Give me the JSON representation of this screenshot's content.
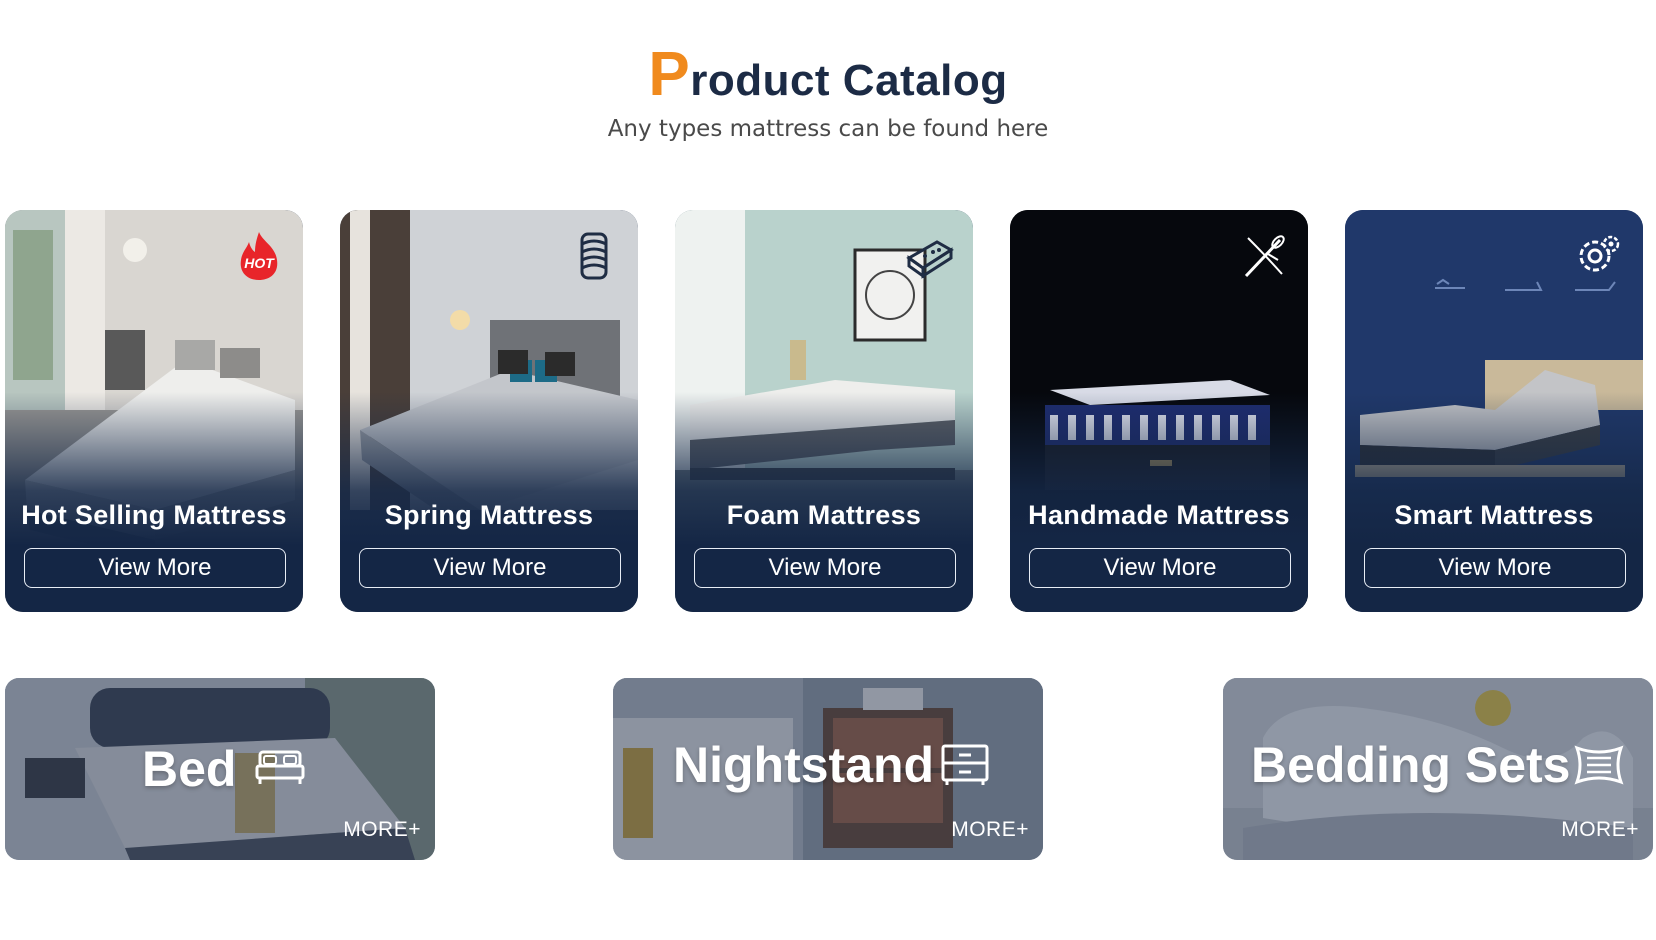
{
  "header": {
    "title_first_letter": "P",
    "title_rest": "roduct Catalog",
    "subtitle": "Any types mattress can be found here",
    "accent_color": "#f08a1d",
    "title_color": "#1c2b45"
  },
  "cards": [
    {
      "title": "Hot Selling Mattress",
      "button": "View More",
      "icon": "hot-flame-icon",
      "badge_text": "HOT"
    },
    {
      "title": "Spring Mattress",
      "button": "View More",
      "icon": "coil-spring-icon"
    },
    {
      "title": "Foam Mattress",
      "button": "View More",
      "icon": "foam-block-icon"
    },
    {
      "title": "Handmade Mattress",
      "button": "View More",
      "icon": "needle-thread-icon"
    },
    {
      "title": "Smart Mattress",
      "button": "View More",
      "icon": "gear-icon"
    }
  ],
  "wide_tiles": [
    {
      "title": "Bed",
      "more": "MORE+",
      "icon": "bed-icon"
    },
    {
      "title": "Nightstand",
      "more": "MORE+",
      "icon": "drawer-cabinet-icon"
    },
    {
      "title": "Bedding Sets",
      "more": "MORE+",
      "icon": "pillow-icon"
    }
  ],
  "colors": {
    "card_bg": "#152847",
    "tile_overlay": "#1e2d48"
  }
}
